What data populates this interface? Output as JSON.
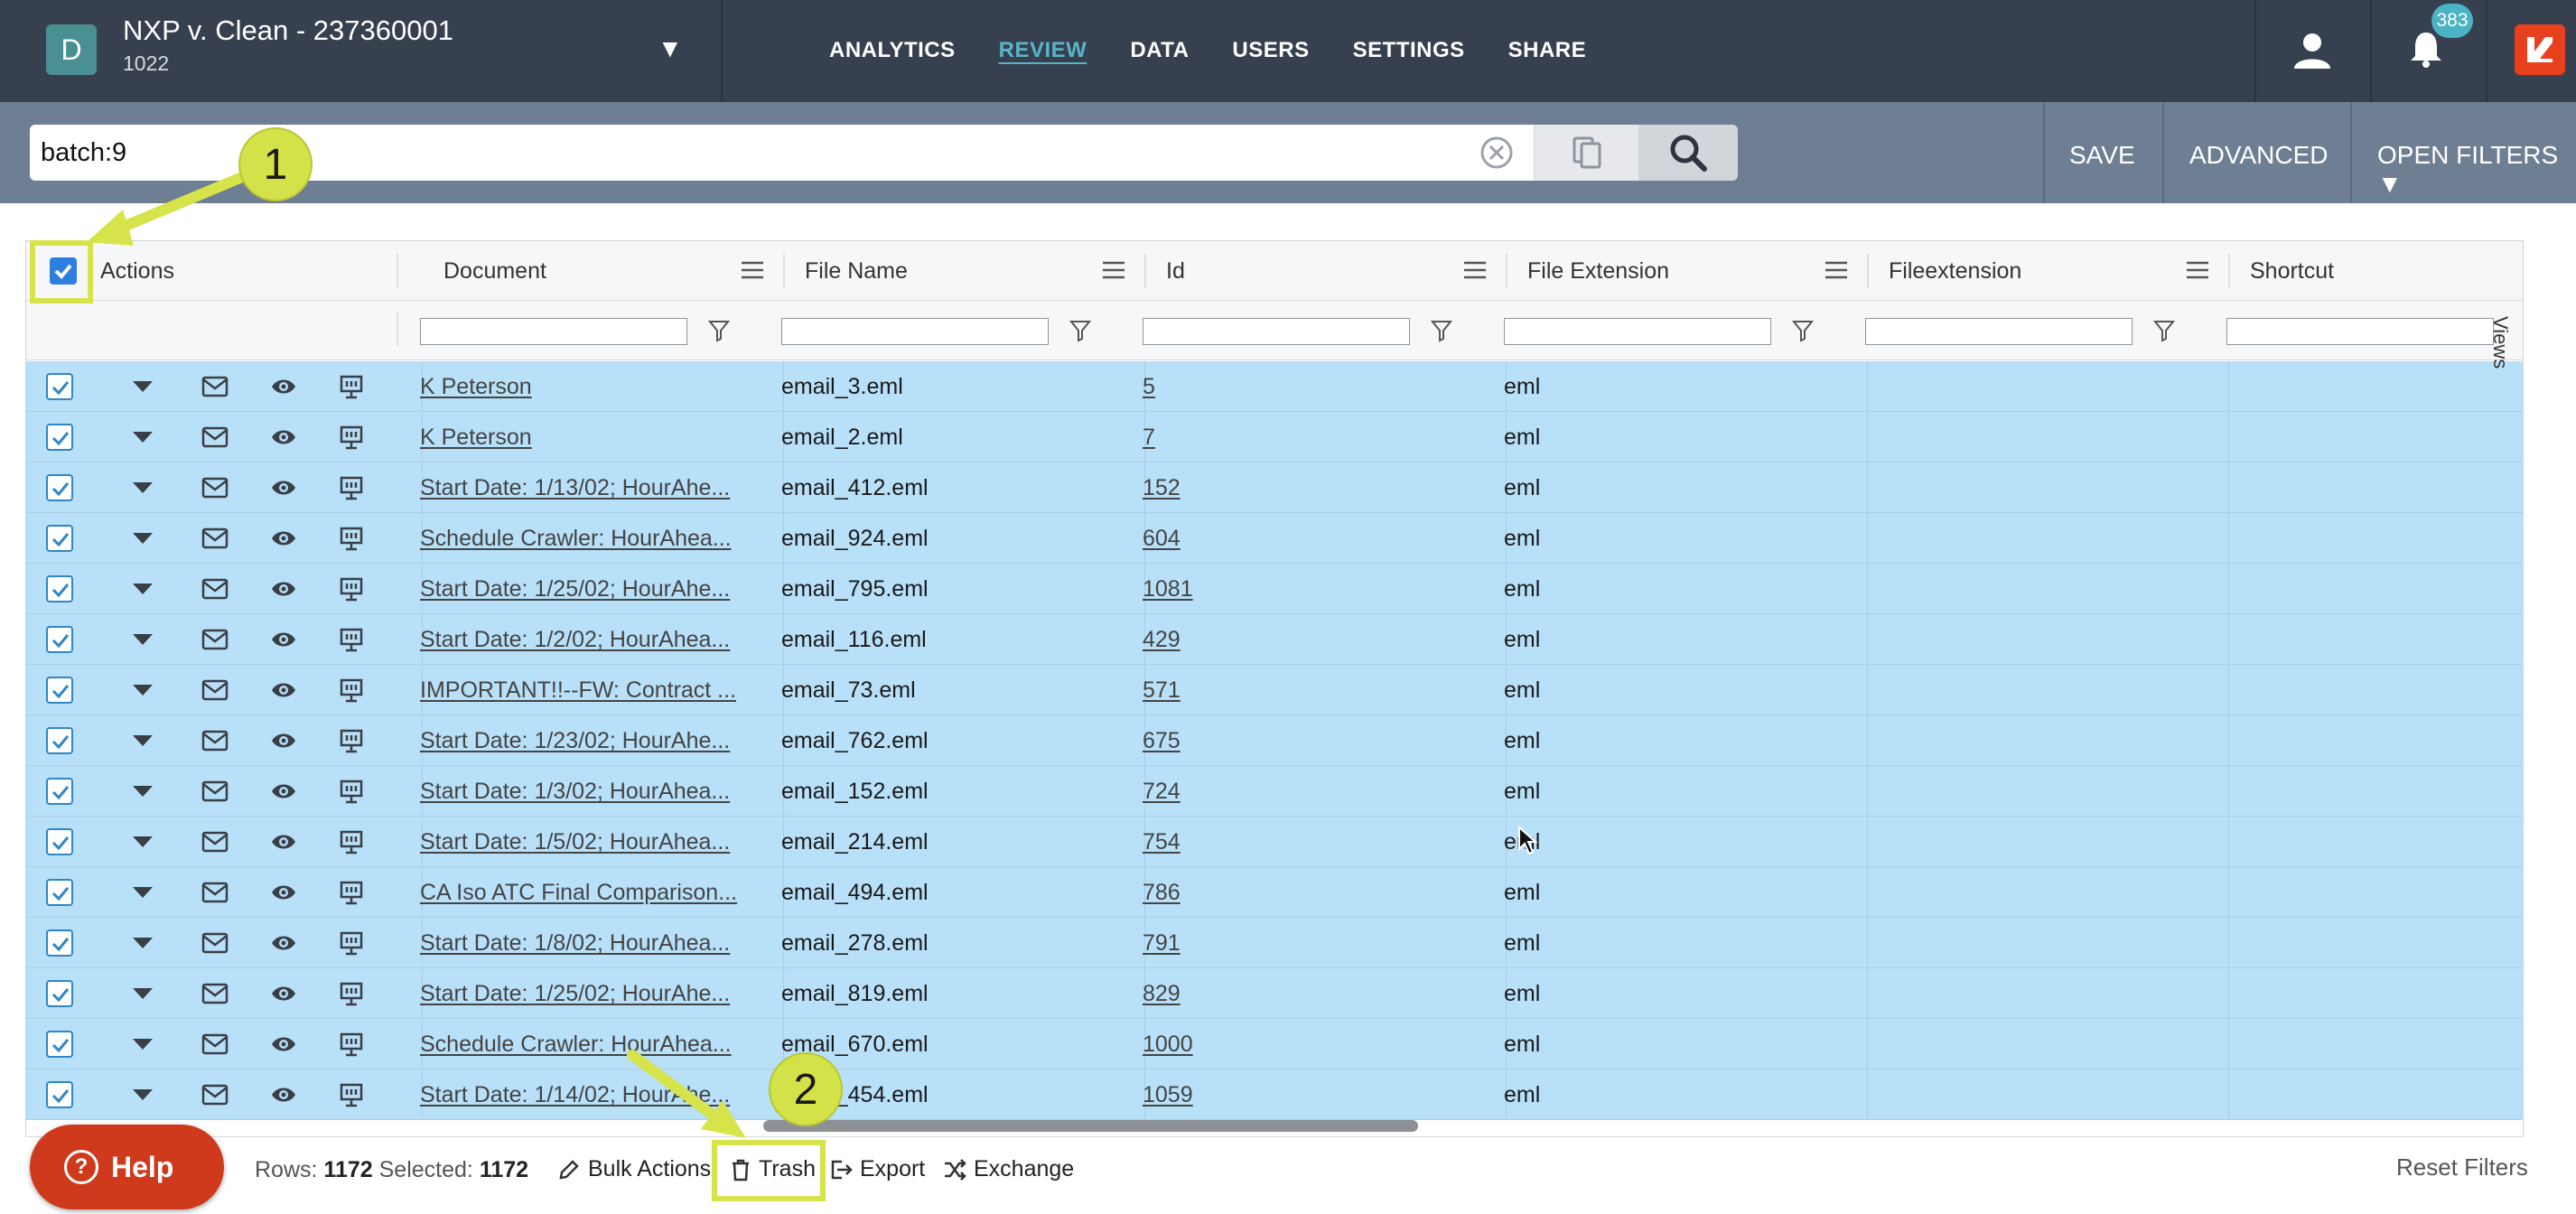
{
  "header": {
    "case_initial": "D",
    "case_title": "NXP v. Clean - 237360001",
    "case_subtitle": "1022",
    "nav": [
      "ANALYTICS",
      "REVIEW",
      "DATA",
      "USERS",
      "SETTINGS",
      "SHARE"
    ],
    "active_nav": "REVIEW",
    "notification_count": "383",
    "colors": {
      "topbar": "#36404f",
      "accent": "#5ab4c8",
      "brand": "#e8401c"
    }
  },
  "search": {
    "query": "batch:9",
    "buttons": {
      "save": "SAVE",
      "advanced": "ADVANCED",
      "open_filters": "OPEN FILTERS ▼"
    }
  },
  "grid": {
    "columns": [
      "Actions",
      "Document",
      "File Name",
      "Id",
      "File Extension",
      "Fileextension",
      "Shortcut"
    ],
    "views_label": "Views",
    "rows": [
      {
        "document": "K Peterson",
        "file_name": "email_3.eml",
        "id": "5",
        "ext": "eml"
      },
      {
        "document": "K Peterson",
        "file_name": "email_2.eml",
        "id": "7",
        "ext": "eml"
      },
      {
        "document": "Start Date: 1/13/02; HourAhe...",
        "file_name": "email_412.eml",
        "id": "152",
        "ext": "eml"
      },
      {
        "document": "Schedule Crawler: HourAhea...",
        "file_name": "email_924.eml",
        "id": "604",
        "ext": "eml"
      },
      {
        "document": "Start Date: 1/25/02; HourAhe...",
        "file_name": "email_795.eml",
        "id": "1081",
        "ext": "eml"
      },
      {
        "document": "Start Date: 1/2/02; HourAhea...",
        "file_name": "email_116.eml",
        "id": "429",
        "ext": "eml"
      },
      {
        "document": "IMPORTANT!!--FW: Contract ...",
        "file_name": "email_73.eml",
        "id": "571",
        "ext": "eml"
      },
      {
        "document": "Start Date: 1/23/02; HourAhe...",
        "file_name": "email_762.eml",
        "id": "675",
        "ext": "eml"
      },
      {
        "document": "Start Date: 1/3/02; HourAhea...",
        "file_name": "email_152.eml",
        "id": "724",
        "ext": "eml"
      },
      {
        "document": "Start Date: 1/5/02; HourAhea...",
        "file_name": "email_214.eml",
        "id": "754",
        "ext": "eml"
      },
      {
        "document": "CA Iso ATC Final Comparison...",
        "file_name": "email_494.eml",
        "id": "786",
        "ext": "eml"
      },
      {
        "document": "Start Date: 1/8/02; HourAhea...",
        "file_name": "email_278.eml",
        "id": "791",
        "ext": "eml"
      },
      {
        "document": "Start Date: 1/25/02; HourAhe...",
        "file_name": "email_819.eml",
        "id": "829",
        "ext": "eml"
      },
      {
        "document": "Schedule Crawler: HourAhea...",
        "file_name": "email_670.eml",
        "id": "1000",
        "ext": "eml"
      },
      {
        "document": "Start Date: 1/14/02; HourAhe...",
        "file_name": "email_454.eml",
        "id": "1059",
        "ext": "eml"
      }
    ],
    "selected_row_color": "#b8e0f9"
  },
  "footer": {
    "help": "Help",
    "rows_label": "Rows:",
    "rows_value": "1172",
    "selected_label": "Selected:",
    "selected_value": "1172",
    "bulk_actions": "Bulk Actions",
    "trash": "Trash",
    "export": "Export",
    "exchange": "Exchange",
    "reset_filters": "Reset Filters"
  },
  "annotations": {
    "step1": "1",
    "step2": "2",
    "highlight_color": "#d7e34a"
  }
}
